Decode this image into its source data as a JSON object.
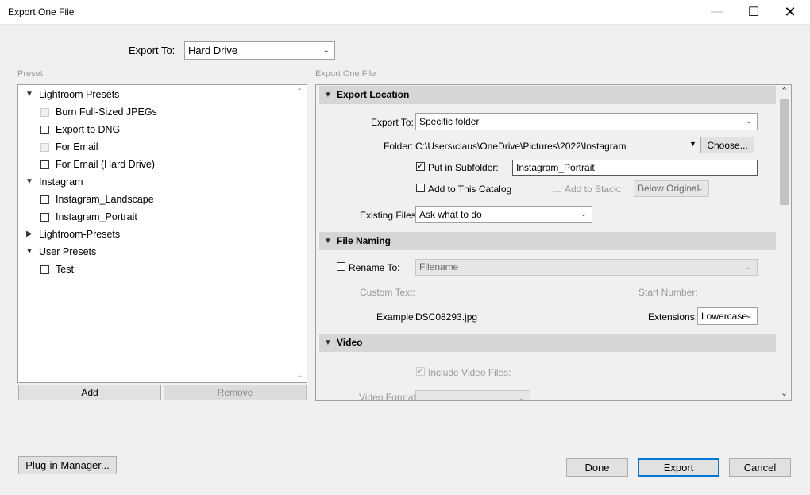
{
  "window": {
    "title": "Export One File",
    "minimize": "—",
    "maximize": "☐",
    "close": "✕"
  },
  "top": {
    "export_to_label": "Export To:",
    "export_to_value": "Hard Drive"
  },
  "preset": {
    "label": "Preset:",
    "folders": [
      {
        "name": "Lightroom Presets",
        "expanded": true
      },
      {
        "name": "Instagram",
        "expanded": true
      },
      {
        "name": "Lightroom-Presets",
        "expanded": false
      },
      {
        "name": "User Presets",
        "expanded": true
      }
    ],
    "items": [
      {
        "name": "Burn Full-Sized JPEGs",
        "enabled": false
      },
      {
        "name": "Export to DNG",
        "enabled": true
      },
      {
        "name": "For Email",
        "enabled": false
      },
      {
        "name": "For Email (Hard Drive)",
        "enabled": true
      },
      {
        "name": "Instagram_Landscape",
        "enabled": true
      },
      {
        "name": "Instagram_Portrait",
        "enabled": true
      },
      {
        "name": "Test",
        "enabled": true
      }
    ],
    "add_label": "Add",
    "remove_label": "Remove"
  },
  "settings": {
    "title": "Export One File",
    "export_location": {
      "header": "Export Location",
      "export_to_label": "Export To:",
      "export_to_value": "Specific folder",
      "folder_label": "Folder:",
      "folder_path": "C:\\Users\\claus\\OneDrive\\Pictures\\2022\\Instagram",
      "choose_label": "Choose...",
      "put_in_subfolder_label": "Put in Subfolder:",
      "put_in_subfolder_checked": true,
      "subfolder_value": "Instagram_Portrait",
      "add_to_catalog_label": "Add to This Catalog",
      "add_to_stack_label": "Add to Stack:",
      "stack_value": "Below Original",
      "existing_files_label": "Existing Files:",
      "existing_files_value": "Ask what to do"
    },
    "file_naming": {
      "header": "File Naming",
      "rename_to_label": "Rename To:",
      "rename_value": "Filename",
      "custom_text_label": "Custom Text:",
      "start_number_label": "Start Number:",
      "example_label": "Example:",
      "example_value": "DSC08293.jpg",
      "extensions_label": "Extensions:",
      "extensions_value": "Lowercase"
    },
    "video": {
      "header": "Video",
      "include_video_label": "Include Video Files:",
      "video_format_label": "Video Format:"
    }
  },
  "footer": {
    "plugin_manager_label": "Plug-in Manager...",
    "done_label": "Done",
    "export_label": "Export",
    "cancel_label": "Cancel"
  },
  "colors": {
    "accent": "#0078d7",
    "section_header": "#d6d6d6",
    "background": "#f0f0f0"
  }
}
